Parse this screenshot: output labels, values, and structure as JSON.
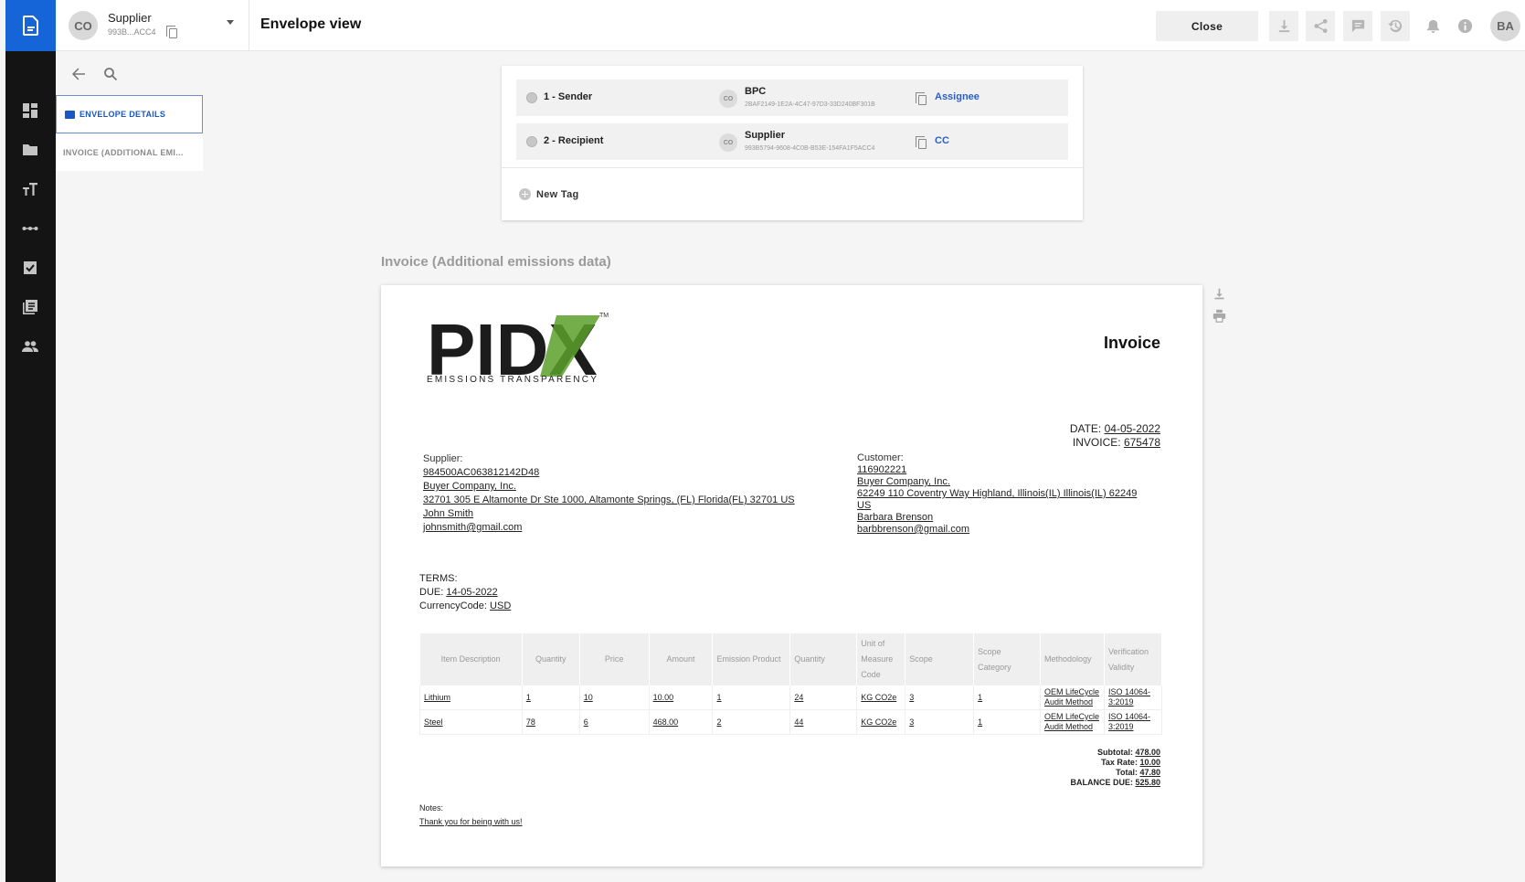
{
  "header": {
    "account_initials": "CO",
    "account_name": "Supplier",
    "account_id": "993B...ACC4",
    "page_title": "Envelope view",
    "close_label": "Close",
    "user_initials": "BA"
  },
  "rail": {
    "icons": [
      "document-icon",
      "dashboard-icon",
      "folder-icon",
      "text-size-icon",
      "connection-icon",
      "checklist-icon",
      "library-icon",
      "people-icon"
    ]
  },
  "side_panel": {
    "active_item": "ENVELOPE DETAILS",
    "items": [
      "INVOICE (ADDITIONAL EMI..."
    ]
  },
  "signers": [
    {
      "role": "1 - Sender",
      "initials": "CO",
      "name": "BPC",
      "id": "2BAF2149-1E2A-4C47-97D3-33D240BF301B",
      "type": "Assignee"
    },
    {
      "role": "2 - Recipient",
      "initials": "CO",
      "name": "Supplier",
      "id": "993B5794-9608-4C0B-B53E-154FA1F5ACC4",
      "type": "CC"
    }
  ],
  "new_tag_label": "New Tag",
  "document_title": "Invoice (Additional emissions data)",
  "invoice": {
    "logo_text": "PIDX",
    "logo_subtitle": "EMISSIONS TRANSPARENCY",
    "logo_tm": "TM",
    "heading": "Invoice",
    "date_label": "DATE:",
    "date": "04-05-2022",
    "invoice_label": "INVOICE:",
    "invoice_number": "675478",
    "supplier": {
      "label": "Supplier:",
      "lines": [
        "984500AC063812142D48",
        "Buyer Company, Inc.",
        "32701 305 E Altamonte Dr Ste 1000, Altamonte Springs, (FL) Florida(FL) 32701 US",
        "John Smith",
        "johnsmith@gmail.com"
      ]
    },
    "customer": {
      "label": "Customer:",
      "lines": [
        "116902221",
        "Buyer Company, Inc.",
        "62249 110 Coventry Way Highland, Illinois(IL) Illinois(IL) 62249",
        "US",
        "Barbara Brenson",
        "barbbrenson@gmail.com"
      ]
    },
    "terms": {
      "label": "TERMS:",
      "due_label": "DUE:",
      "due": "14-05-2022",
      "currency_label": "CurrencyCode:",
      "currency": "USD"
    },
    "columns": [
      "Item Description",
      "Quantity",
      "Price",
      "Amount",
      "Emission Product",
      "Quantity",
      "Unit of Measure Code",
      "Scope",
      "Scope Category",
      "Methodology",
      "Verification Validity"
    ],
    "rows": [
      [
        "Lithium",
        "1",
        "10",
        "10.00",
        "1",
        "24",
        "KG CO2e",
        "3",
        "1",
        "OEM LifeCycle Audit Method",
        "ISO 14064-3:2019"
      ],
      [
        "Steel",
        "78",
        "6",
        "468.00",
        "2",
        "44",
        "KG CO2e",
        "3",
        "1",
        "OEM LifeCycle Audit Method",
        "ISO 14064-3:2019"
      ]
    ],
    "totals": {
      "subtotal_label": "Subtotal:",
      "subtotal": "478.00",
      "tax_label": "Tax Rate:",
      "tax": "10.00",
      "total_label": "Total:",
      "total": "47.80",
      "balance_label": "BALANCE DUE:",
      "balance": "525.80"
    },
    "notes_label": "Notes:",
    "notes": "Thank you for being with us!"
  },
  "colors": {
    "brand_blue": "#1565d8",
    "rail_bg": "#141414",
    "link_blue": "#2a5fc7",
    "logo_green": "#5aa02c"
  }
}
